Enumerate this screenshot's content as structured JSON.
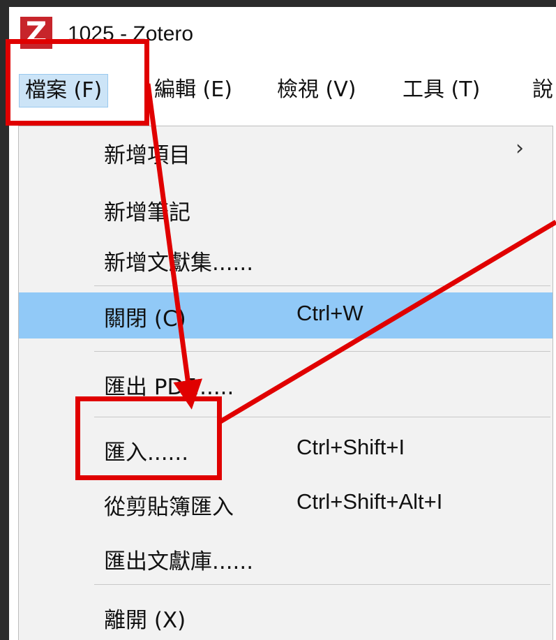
{
  "window": {
    "title": "1025 - Zotero",
    "logo_letter": "Z"
  },
  "menubar": {
    "items": [
      {
        "label": "檔案 (F)"
      },
      {
        "label": "編輯 (E)"
      },
      {
        "label": "檢視 (V)"
      },
      {
        "label": "工具 (T)"
      },
      {
        "label": "說"
      }
    ]
  },
  "file_menu": {
    "items": [
      {
        "label": "新增項目",
        "shortcut": "",
        "submenu_icon": "chevron-right-icon",
        "submenu_glyph": "›"
      },
      {
        "label": "新增筆記",
        "shortcut": ""
      },
      {
        "label": "新增文獻集......",
        "shortcut": ""
      },
      {
        "label": "關閉 (C)",
        "shortcut": "Ctrl+W"
      },
      {
        "label": "匯出 PDF......",
        "shortcut": ""
      },
      {
        "label": "匯入......",
        "shortcut": "Ctrl+Shift+I"
      },
      {
        "label": "從剪貼簿匯入",
        "shortcut": "Ctrl+Shift+Alt+I"
      },
      {
        "label": "匯出文獻庫......",
        "shortcut": ""
      },
      {
        "label": "離開 (X)",
        "shortcut": ""
      }
    ]
  },
  "colors": {
    "highlight": "#91c9f7",
    "annotation": "#e00000",
    "logo": "#c7252b"
  }
}
